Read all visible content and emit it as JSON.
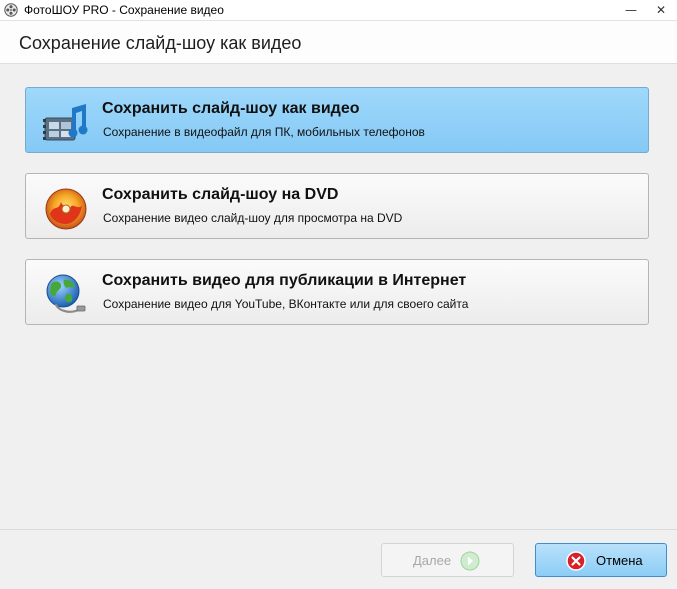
{
  "window": {
    "title": "ФотоШОУ PRO - Сохранение видео",
    "icons": [
      "film-reel-icon",
      "minimize-icon",
      "close-icon"
    ]
  },
  "header": {
    "title": "Сохранение слайд-шоу как видео"
  },
  "options": [
    {
      "title": "Сохранить слайд-шоу как видео",
      "description": "Сохранение в видеофайл для ПК, мобильных телефонов",
      "icon": "video-file-icon",
      "selected": true
    },
    {
      "title": "Сохранить слайд-шоу на DVD",
      "description": "Сохранение видео слайд-шоу для просмотра на DVD",
      "icon": "dvd-disc-icon",
      "selected": false
    },
    {
      "title": "Сохранить видео для публикации в Интернет",
      "description": "Сохранение видео для YouTube, ВКонтакте или для своего сайта",
      "icon": "globe-icon",
      "selected": false
    }
  ],
  "footer": {
    "next_label": "Далее",
    "next_enabled": false,
    "cancel_label": "Отмена"
  },
  "colors": {
    "selected_bg": "#8fcff7",
    "cancel_bg": "#a3d8f9",
    "cancel_icon": "#d9202a",
    "next_icon": "#8fd48f"
  }
}
